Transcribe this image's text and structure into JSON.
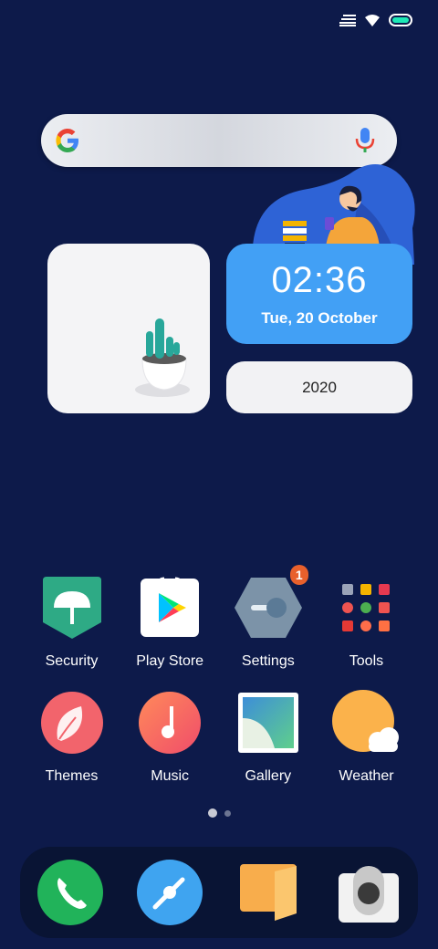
{
  "status_bar": {
    "icons": [
      "signal-icon",
      "wifi-icon",
      "battery-icon"
    ],
    "battery_color": "#1de9b6"
  },
  "search": {
    "icons": [
      "google-g-icon",
      "microphone-icon"
    ]
  },
  "widgets": {
    "clock": {
      "time": "02:36",
      "date": "Tue, 20 October"
    },
    "year": {
      "label": "2020"
    }
  },
  "apps": [
    [
      {
        "id": "security",
        "label": "Security",
        "icon": "umbrella-shield-icon"
      },
      {
        "id": "play-store",
        "label": "Play Store",
        "icon": "play-store-icon"
      },
      {
        "id": "settings",
        "label": "Settings",
        "icon": "hexagon-toggle-icon",
        "badge": "1"
      },
      {
        "id": "tools",
        "label": "Tools",
        "icon": "folder-grid-icon"
      }
    ],
    [
      {
        "id": "themes",
        "label": "Themes",
        "icon": "leaf-icon"
      },
      {
        "id": "music",
        "label": "Music",
        "icon": "music-note-icon"
      },
      {
        "id": "gallery",
        "label": "Gallery",
        "icon": "picture-icon"
      },
      {
        "id": "weather",
        "label": "Weather",
        "icon": "sun-cloud-icon"
      }
    ]
  ],
  "pages": {
    "current": 1,
    "total": 2
  },
  "dock": [
    {
      "id": "phone",
      "icon": "phone-icon"
    },
    {
      "id": "browser",
      "icon": "compass-icon"
    },
    {
      "id": "notes",
      "icon": "notebook-icon"
    },
    {
      "id": "camera",
      "icon": "camera-icon"
    }
  ],
  "colors": {
    "background": "#0d1a4a",
    "clock_widget": "#42a0f5",
    "security": "#2eaa85",
    "badge": "#e8602c"
  }
}
